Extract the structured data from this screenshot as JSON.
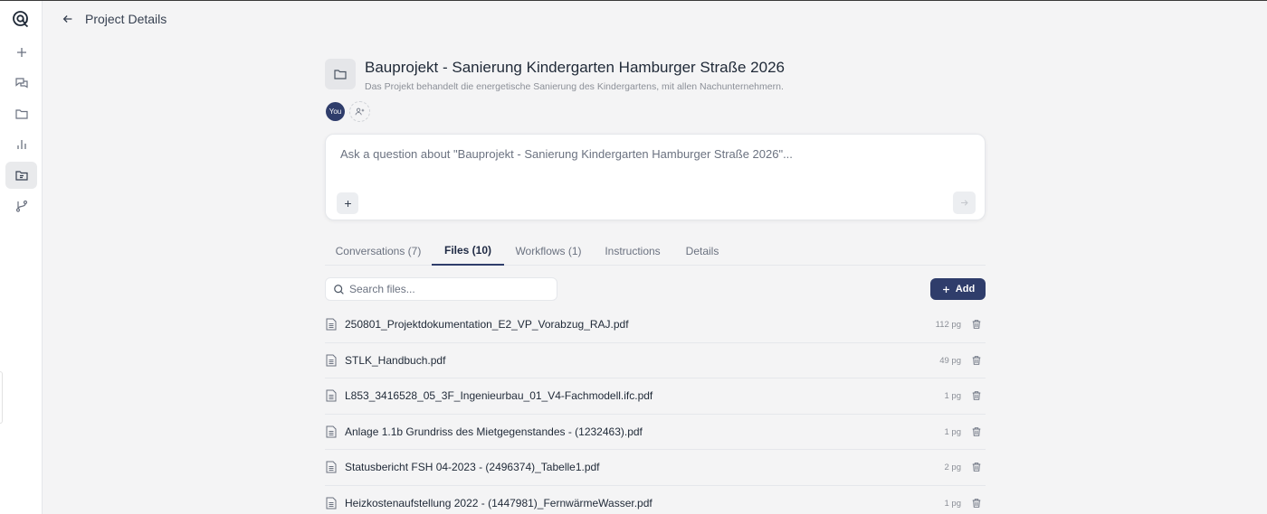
{
  "header": {
    "title": "Project Details"
  },
  "sidebar": {
    "items": [
      {
        "icon": "plus-icon"
      },
      {
        "icon": "chats-icon"
      },
      {
        "icon": "folder-icon"
      },
      {
        "icon": "bar-chart-icon"
      },
      {
        "icon": "projects-folder-icon",
        "active": true
      },
      {
        "icon": "workflow-branch-icon"
      }
    ]
  },
  "project": {
    "title": "Bauprojekt - Sanierung Kindergarten Hamburger Straße 2026",
    "description": "Das Projekt behandelt die energetische Sanierung des Kindergartens, mit allen Nachunternehmern.",
    "member_label": "You"
  },
  "ask": {
    "placeholder": "Ask a question about \"Bauprojekt - Sanierung Kindergarten Hamburger Straße 2026\"..."
  },
  "tabs": [
    {
      "label": "Conversations (7)"
    },
    {
      "label": "Files (10)",
      "active": true
    },
    {
      "label": "Workflows (1)"
    },
    {
      "label": "Instructions"
    },
    {
      "label": "Details"
    }
  ],
  "files": {
    "search_placeholder": "Search files...",
    "add_label": "Add",
    "items": [
      {
        "name": "250801_Projektdokumentation_E2_VP_Vorabzug_RAJ.pdf",
        "pages": "112 pg"
      },
      {
        "name": "STLK_Handbuch.pdf",
        "pages": "49 pg"
      },
      {
        "name": "L853_3416528_05_3F_Ingenieurbau_01_V4-Fachmodell.ifc.pdf",
        "pages": "1 pg"
      },
      {
        "name": "Anlage 1.1b Grundriss des Mietgegenstandes - (1232463).pdf",
        "pages": "1 pg"
      },
      {
        "name": "Statusbericht FSH 04-2023 - (2496374)_Tabelle1.pdf",
        "pages": "2 pg"
      },
      {
        "name": "Heizkostenaufstellung 2022 - (1447981)_FernwärmeWasser.pdf",
        "pages": "1 pg"
      }
    ]
  },
  "colors": {
    "accent": "#2f3d6b",
    "background": "#f4f4f5",
    "muted_text": "#8b8f97"
  }
}
